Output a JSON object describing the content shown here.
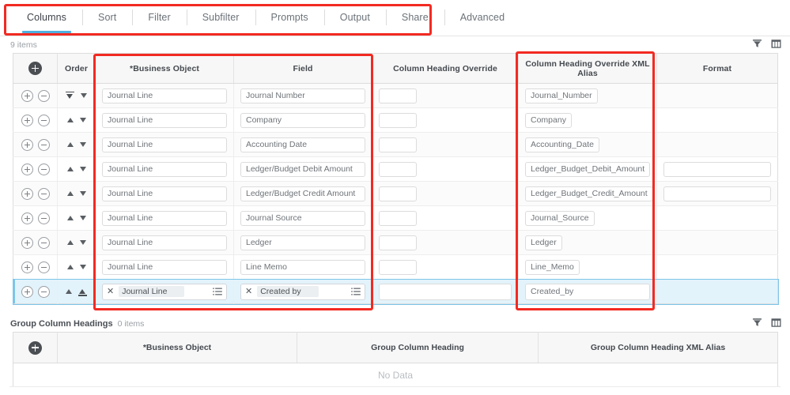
{
  "tabs": {
    "items": [
      {
        "label": "Columns",
        "active": true
      },
      {
        "label": "Sort",
        "active": false
      },
      {
        "label": "Filter",
        "active": false
      },
      {
        "label": "Subfilter",
        "active": false
      },
      {
        "label": "Prompts",
        "active": false
      },
      {
        "label": "Output",
        "active": false
      },
      {
        "label": "Share",
        "active": false
      },
      {
        "label": "Advanced",
        "active": false
      }
    ]
  },
  "columns_grid": {
    "count_label": "9 items",
    "icons": {
      "filter": "filter-funnel-icon",
      "grid": "column-chooser-icon"
    },
    "headers": {
      "actions": "",
      "order": "Order",
      "business_object": "*Business Object",
      "field": "Field",
      "column_heading_override": "Column Heading Override",
      "column_heading_override_xml_alias": "Column Heading Override XML Alias",
      "format": "Format"
    },
    "rows": [
      {
        "order_first": true,
        "business_object": "Journal Line",
        "field": "Journal Number",
        "override": "",
        "xml_alias": "Journal_Number",
        "format": "",
        "format_input": false,
        "selected": false
      },
      {
        "order_first": false,
        "business_object": "Journal Line",
        "field": "Company",
        "override": "",
        "xml_alias": "Company",
        "format": "",
        "format_input": false,
        "selected": false
      },
      {
        "order_first": false,
        "business_object": "Journal Line",
        "field": "Accounting Date",
        "override": "",
        "xml_alias": "Accounting_Date",
        "format": "",
        "format_input": false,
        "selected": false
      },
      {
        "order_first": false,
        "business_object": "Journal Line",
        "field": "Ledger/Budget Debit Amount",
        "override": "",
        "xml_alias": "Ledger_Budget_Debit_Amount",
        "format": "",
        "format_input": true,
        "selected": false
      },
      {
        "order_first": false,
        "business_object": "Journal Line",
        "field": "Ledger/Budget Credit Amount",
        "override": "",
        "xml_alias": "Ledger_Budget_Credit_Amount",
        "format": "",
        "format_input": true,
        "selected": false
      },
      {
        "order_first": false,
        "business_object": "Journal Line",
        "field": "Journal Source",
        "override": "",
        "xml_alias": "Journal_Source",
        "format": "",
        "format_input": false,
        "selected": false
      },
      {
        "order_first": false,
        "business_object": "Journal Line",
        "field": "Ledger",
        "override": "",
        "xml_alias": "Ledger",
        "format": "",
        "format_input": false,
        "selected": false
      },
      {
        "order_first": false,
        "business_object": "Journal Line",
        "field": "Line Memo",
        "override": "",
        "xml_alias": "Line_Memo",
        "format": "",
        "format_input": false,
        "selected": false
      }
    ],
    "selected_row": {
      "business_object_chip": "Journal Line",
      "field_chip": "Created by",
      "override": "",
      "xml_alias": "Created_by",
      "format": "",
      "remove_glyph": "✕",
      "list_icon": "list-options-icon"
    }
  },
  "group_headings_grid": {
    "title": "Group Column Headings",
    "count_label": "0 items",
    "headers": {
      "actions": "",
      "business_object": "*Business Object",
      "group_column_heading": "Group Column Heading",
      "group_column_heading_xml_alias": "Group Column Heading XML Alias"
    },
    "empty_text": "No Data"
  },
  "annotations": {
    "boxes": [
      {
        "name": "tabs-highlight"
      },
      {
        "name": "business-object-field-highlight"
      },
      {
        "name": "xml-alias-highlight"
      }
    ],
    "color": "#f22a22"
  },
  "theme": {
    "accent": "#4fb0e0",
    "selected_row_bg": "#e3f3fb",
    "header_bg": "#f7f7f7"
  }
}
